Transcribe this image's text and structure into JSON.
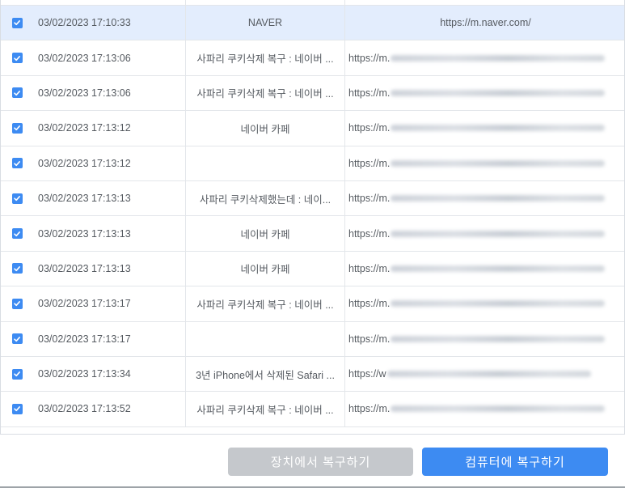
{
  "colors": {
    "accent": "#3d8bf2",
    "selected_row": "#e3edfd",
    "disabled_button": "#c5c8cc"
  },
  "rows": [
    {
      "time": "03/02/2023 17:10:33",
      "title": "NAVER",
      "url": "https://m.naver.com/",
      "checked": true,
      "selected": true
    },
    {
      "time": "03/02/2023 17:13:06",
      "title": "사파리 쿠키삭제 복구 : 네이버 ...",
      "url": "https://m.",
      "checked": true
    },
    {
      "time": "03/02/2023 17:13:06",
      "title": "사파리 쿠키삭제 복구 : 네이버 ...",
      "url": "https://m.",
      "checked": true
    },
    {
      "time": "03/02/2023 17:13:12",
      "title": "네이버 카페",
      "url": "https://m.",
      "checked": true
    },
    {
      "time": "03/02/2023 17:13:12",
      "title": "",
      "url": "https://m.",
      "checked": true
    },
    {
      "time": "03/02/2023 17:13:13",
      "title": "사파리 쿠키삭제했는데 : 네이...",
      "url": "https://m.",
      "checked": true
    },
    {
      "time": "03/02/2023 17:13:13",
      "title": "네이버 카페",
      "url": "https://m.",
      "checked": true
    },
    {
      "time": "03/02/2023 17:13:13",
      "title": "네이버 카페",
      "url": "https://m.",
      "checked": true
    },
    {
      "time": "03/02/2023 17:13:17",
      "title": "사파리 쿠키삭제 복구 : 네이버 ...",
      "url": "https://m.",
      "checked": true
    },
    {
      "time": "03/02/2023 17:13:17",
      "title": "",
      "url": "https://m.",
      "checked": true
    },
    {
      "time": "03/02/2023 17:13:34",
      "title": "3년 iPhone에서 삭제된 Safari ...",
      "url": "https://w",
      "checked": true
    },
    {
      "time": "03/02/2023 17:13:52",
      "title": "사파리 쿠키삭제 복구 : 네이버 ...",
      "url": "https://m.",
      "checked": true
    }
  ],
  "buttons": {
    "recover_to_device": "장치에서 복구하기",
    "recover_to_computer": "컴퓨터에 복구하기"
  }
}
